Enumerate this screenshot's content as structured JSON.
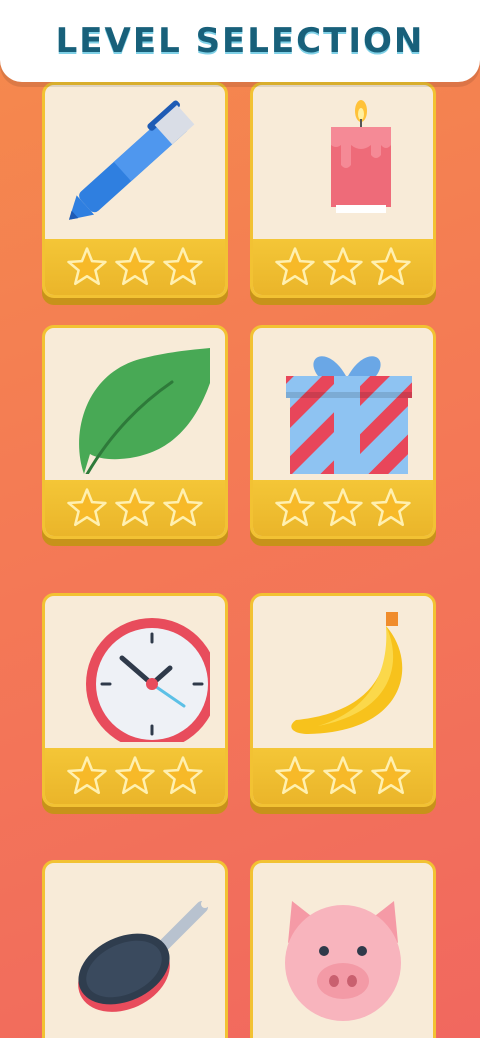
{
  "header": {
    "title": "LEVEL SELECTION"
  },
  "colors": {
    "star": "#f7b928",
    "card_border": "#f2c233",
    "card_bg": "#f8ebd8"
  },
  "levels": [
    {
      "item": "pen-icon",
      "stars": 3,
      "max_stars": 3
    },
    {
      "item": "candle-icon",
      "stars": 3,
      "max_stars": 3
    },
    {
      "item": "leaf-icon",
      "stars": 3,
      "max_stars": 3
    },
    {
      "item": "gift-icon",
      "stars": 3,
      "max_stars": 3
    },
    {
      "item": "clock-icon",
      "stars": 3,
      "max_stars": 3
    },
    {
      "item": "banana-icon",
      "stars": 3,
      "max_stars": 3
    },
    {
      "item": "frying-pan-icon",
      "stars": null,
      "max_stars": 3
    },
    {
      "item": "pig-icon",
      "stars": null,
      "max_stars": 3
    }
  ]
}
